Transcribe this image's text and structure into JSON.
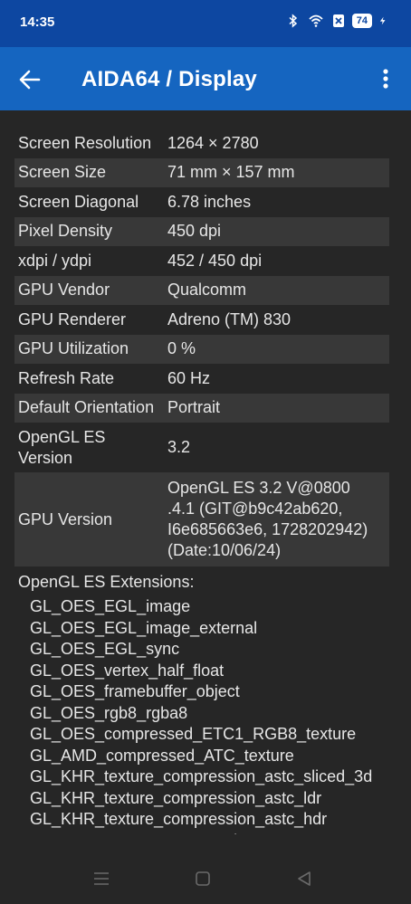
{
  "status": {
    "time": "14:35",
    "battery": "74",
    "icons": [
      "bluetooth-icon",
      "wifi-icon",
      "no-sim-icon",
      "battery-icon",
      "charging-icon"
    ]
  },
  "appbar": {
    "title": "AIDA64  /  Display"
  },
  "rows": [
    {
      "key": "Screen Resolution",
      "value": "1264 × 2780"
    },
    {
      "key": "Screen Size",
      "value": "71 mm × 157 mm"
    },
    {
      "key": "Screen Diagonal",
      "value": "6.78 inches"
    },
    {
      "key": "Pixel Density",
      "value": "450 dpi"
    },
    {
      "key": "xdpi / ydpi",
      "value": "452 / 450 dpi"
    },
    {
      "key": "GPU Vendor",
      "value": "Qualcomm"
    },
    {
      "key": "GPU Renderer",
      "value": "Adreno (TM) 830"
    },
    {
      "key": "GPU Utilization",
      "value": "0 %"
    },
    {
      "key": "Refresh Rate",
      "value": "60 Hz"
    },
    {
      "key": "Default Orientation",
      "value": "Portrait"
    },
    {
      "key": "OpenGL ES\nVersion",
      "value": "3.2"
    },
    {
      "key": "GPU Version",
      "value": "OpenGL ES 3.2 V@0800\n.4.1 (GIT@b9c42ab620,\nI6e685663e6, 1728202942)\n(Date:10/06/24)"
    }
  ],
  "extensions": {
    "heading": "OpenGL ES Extensions:",
    "items": [
      "GL_OES_EGL_image",
      "GL_OES_EGL_image_external",
      "GL_OES_EGL_sync",
      "GL_OES_vertex_half_float",
      "GL_OES_framebuffer_object",
      "GL_OES_rgb8_rgba8",
      "GL_OES_compressed_ETC1_RGB8_texture",
      "GL_AMD_compressed_ATC_texture",
      "GL_KHR_texture_compression_astc_sliced_3d",
      "GL_KHR_texture_compression_astc_ldr",
      "GL_KHR_texture_compression_astc_hdr",
      "GL_OES_texture_compression_astc"
    ]
  },
  "colors": {
    "statusbar": "#0d47a1",
    "appbar": "#1565c0",
    "background": "#262626",
    "row_alt": "#383838"
  }
}
